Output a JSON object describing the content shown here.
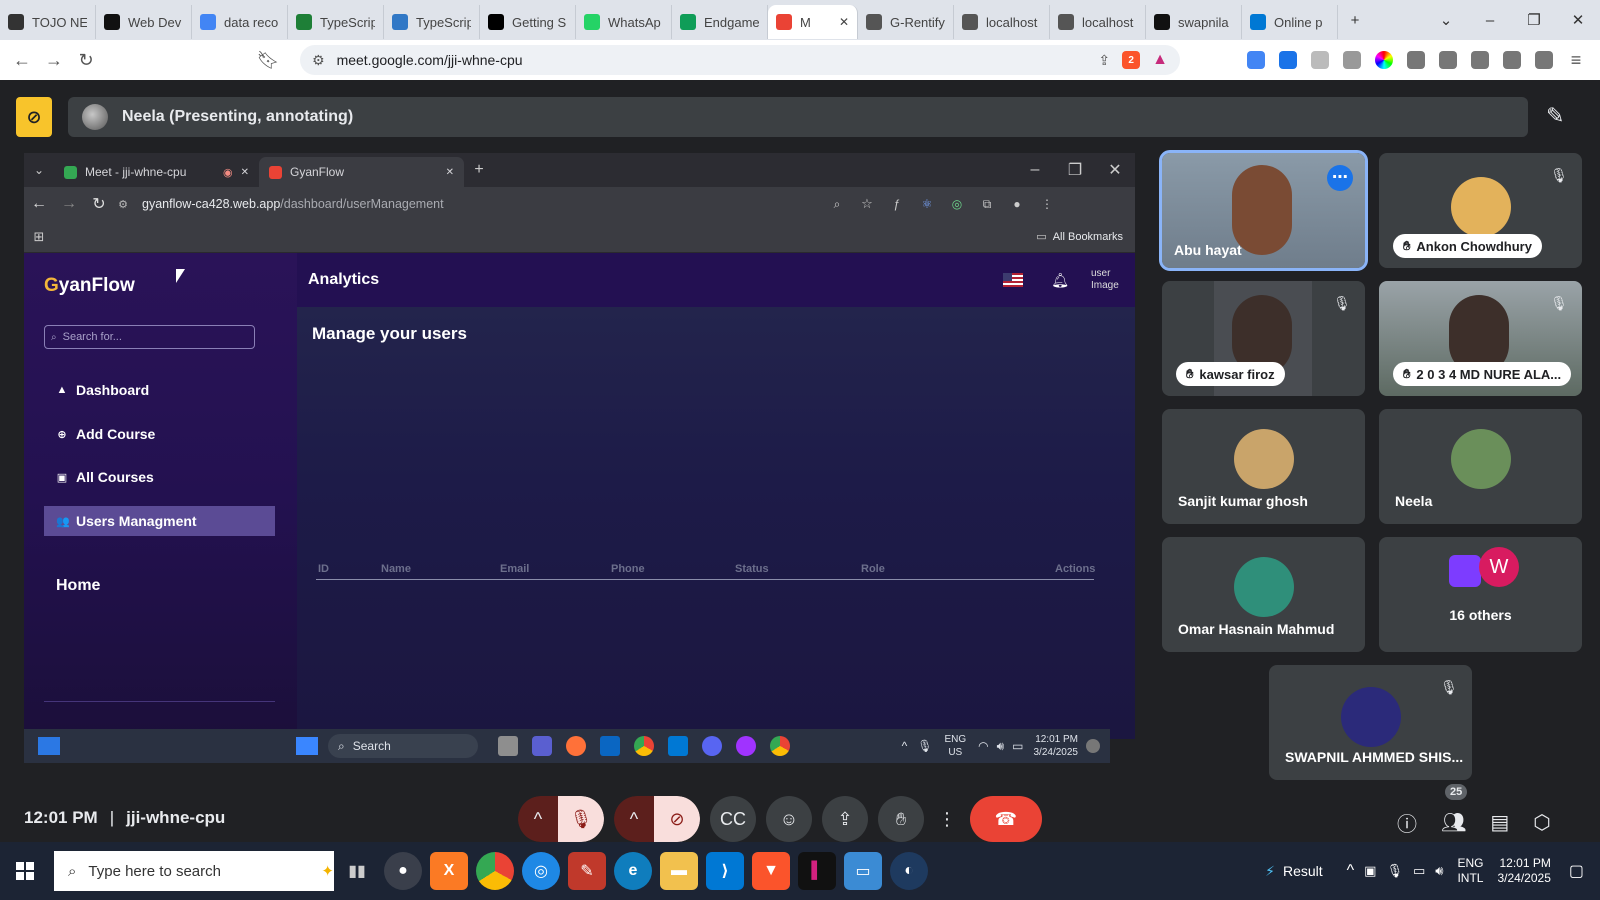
{
  "outer_tabs": [
    {
      "label": "TOJO NE",
      "color": "#333333"
    },
    {
      "label": "Web Dev",
      "color": "#111111"
    },
    {
      "label": "data reco",
      "color": "#4285f4"
    },
    {
      "label": "TypeScrip",
      "color": "#1e7f37"
    },
    {
      "label": "TypeScrip",
      "color": "#3178c6"
    },
    {
      "label": "Getting S",
      "color": "#000000"
    },
    {
      "label": "WhatsAp",
      "color": "#25d366"
    },
    {
      "label": "Endgame",
      "color": "#0f9d58"
    },
    {
      "label": "M",
      "color": "#ea4335",
      "active": true
    },
    {
      "label": "G-Rentify",
      "color": "#555555"
    },
    {
      "label": "localhost",
      "color": "#555555"
    },
    {
      "label": "localhost",
      "color": "#555555"
    },
    {
      "label": "swapnila",
      "color": "#111111"
    },
    {
      "label": "Online p",
      "color": "#0078d4"
    }
  ],
  "outer_address": {
    "url": "meet.google.com/jji-whne-cpu",
    "shield_count": "2"
  },
  "meet": {
    "presenter_text": "Neela (Presenting, annotating)",
    "time": "12:01 PM",
    "separator": "|",
    "meeting_code": "jji-whne-cpu",
    "people_count": "25"
  },
  "shared": {
    "tabs": [
      {
        "label": "Meet - jji-whne-cpu"
      },
      {
        "label": "GyanFlow",
        "active": true
      }
    ],
    "url_host": "gyanflow-ca428.web.app",
    "url_path": "/dashboard/userManagement",
    "bookmarks_label": "All Bookmarks",
    "app": {
      "logo_first": "G",
      "logo_rest": "yanFlow",
      "search_placeholder": "Search for...",
      "nav": [
        {
          "label": "Dashboard",
          "icon": "▲"
        },
        {
          "label": "Add Course",
          "icon": "⊕"
        },
        {
          "label": "All Courses",
          "icon": "▣"
        },
        {
          "label": "Users Managment",
          "icon": "👥",
          "selected": true
        }
      ],
      "home_label": "Home",
      "topbar_title": "Analytics",
      "avatar_alt": "user Image",
      "page_heading": "Manage your users",
      "columns": [
        "ID",
        "Name",
        "Email",
        "Phone",
        "Status",
        "Role",
        "Actions"
      ]
    },
    "taskbar": {
      "search_label": "Search",
      "lang_top": "ENG",
      "lang_bottom": "US",
      "time": "12:01 PM",
      "date": "3/24/2025"
    }
  },
  "participants": [
    {
      "name": "Abu hayat",
      "style": "video",
      "highlight": true
    },
    {
      "name": "Ankon Chowdhury",
      "style": "avatar-chip",
      "muted": true
    },
    {
      "name": "kawsar firoz",
      "style": "video-chip",
      "muted": true
    },
    {
      "name": "2 0 3 4 MD NURE ALA...",
      "style": "video-chip",
      "muted": true
    },
    {
      "name": "Sanjit kumar ghosh",
      "style": "avatar"
    },
    {
      "name": "Neela",
      "style": "avatar"
    },
    {
      "name": "Omar Hasnain Mahmud",
      "style": "avatar"
    },
    {
      "name": "16 others",
      "style": "others",
      "letter": "W"
    },
    {
      "name": "SWAPNIL AHMMED SHIS...",
      "style": "avatar",
      "muted": true
    }
  ],
  "win_taskbar": {
    "search_placeholder": "Type here to search",
    "weather_label": "Result",
    "lang_top": "ENG",
    "lang_bottom": "INTL",
    "time": "12:01 PM",
    "date": "3/24/2025"
  },
  "colors": {
    "meet_bg": "#202124",
    "tile_bg": "#3c4043",
    "end_call": "#ea4335",
    "muted_ctrl": "#f9dedc",
    "presenter_icon": "#f8c42b",
    "app_sidebar": "#2a1358"
  }
}
